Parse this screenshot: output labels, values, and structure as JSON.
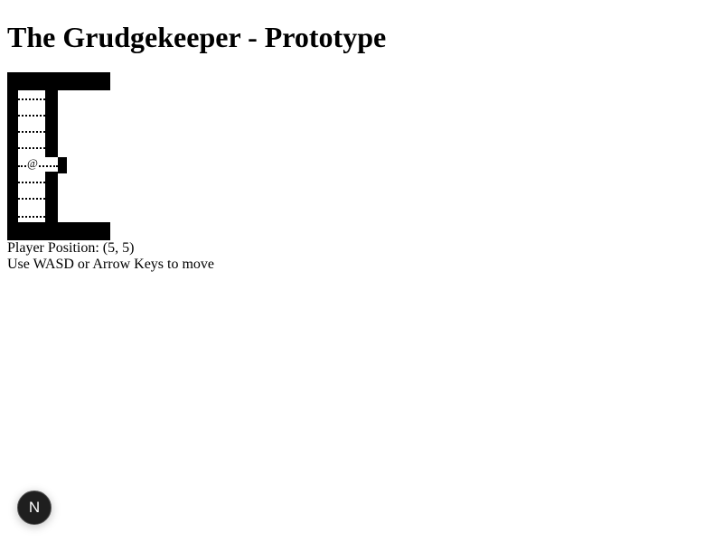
{
  "page": {
    "title": "The Grudgekeeper - Prototype"
  },
  "game": {
    "player_glyph": "@",
    "floor_glyph": "·",
    "player": {
      "col": 5,
      "row": 5
    }
  },
  "status": {
    "position_label": "Player Position:",
    "position_value": "(5, 5)",
    "help_text": "Use WASD or Arrow Keys to move"
  },
  "overlay": {
    "badge_letter": "N"
  },
  "colors": {
    "wall": "#000000",
    "floor": "#ffffff",
    "text": "#000000",
    "badge_bg": "#1f1f1f"
  }
}
